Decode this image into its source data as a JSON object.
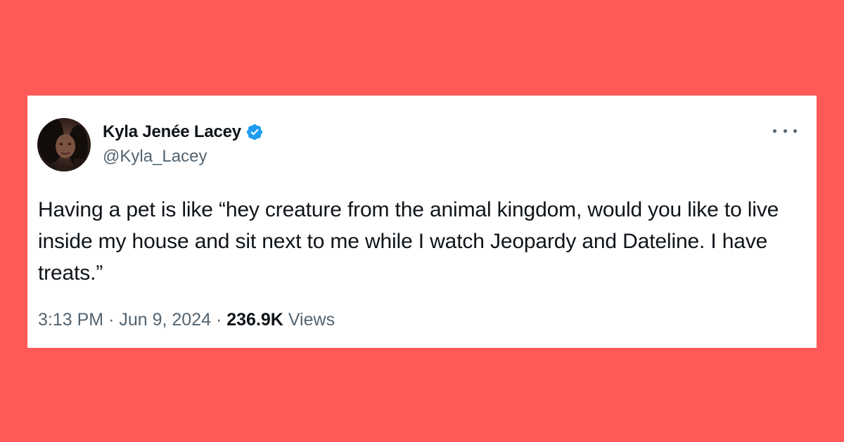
{
  "tweet": {
    "author": {
      "display_name": "Kyla Jenée Lacey",
      "handle": "@Kyla_Lacey",
      "verified": true,
      "avatar_icon": "profile-photo"
    },
    "text": "Having a pet is like “hey creature from the animal kingdom, would you like to live inside my house and sit next to me while I watch Jeopardy and Dateline. I have treats.”",
    "time": "3:13 PM",
    "separator": "·",
    "date": "Jun 9, 2024",
    "views_count": "236.9K",
    "views_label": "Views"
  },
  "colors": {
    "background": "#ff5a58",
    "card": "#ffffff",
    "verified_badge": "#1d9bf0",
    "text_primary": "#0f1419",
    "text_secondary": "#536471"
  }
}
